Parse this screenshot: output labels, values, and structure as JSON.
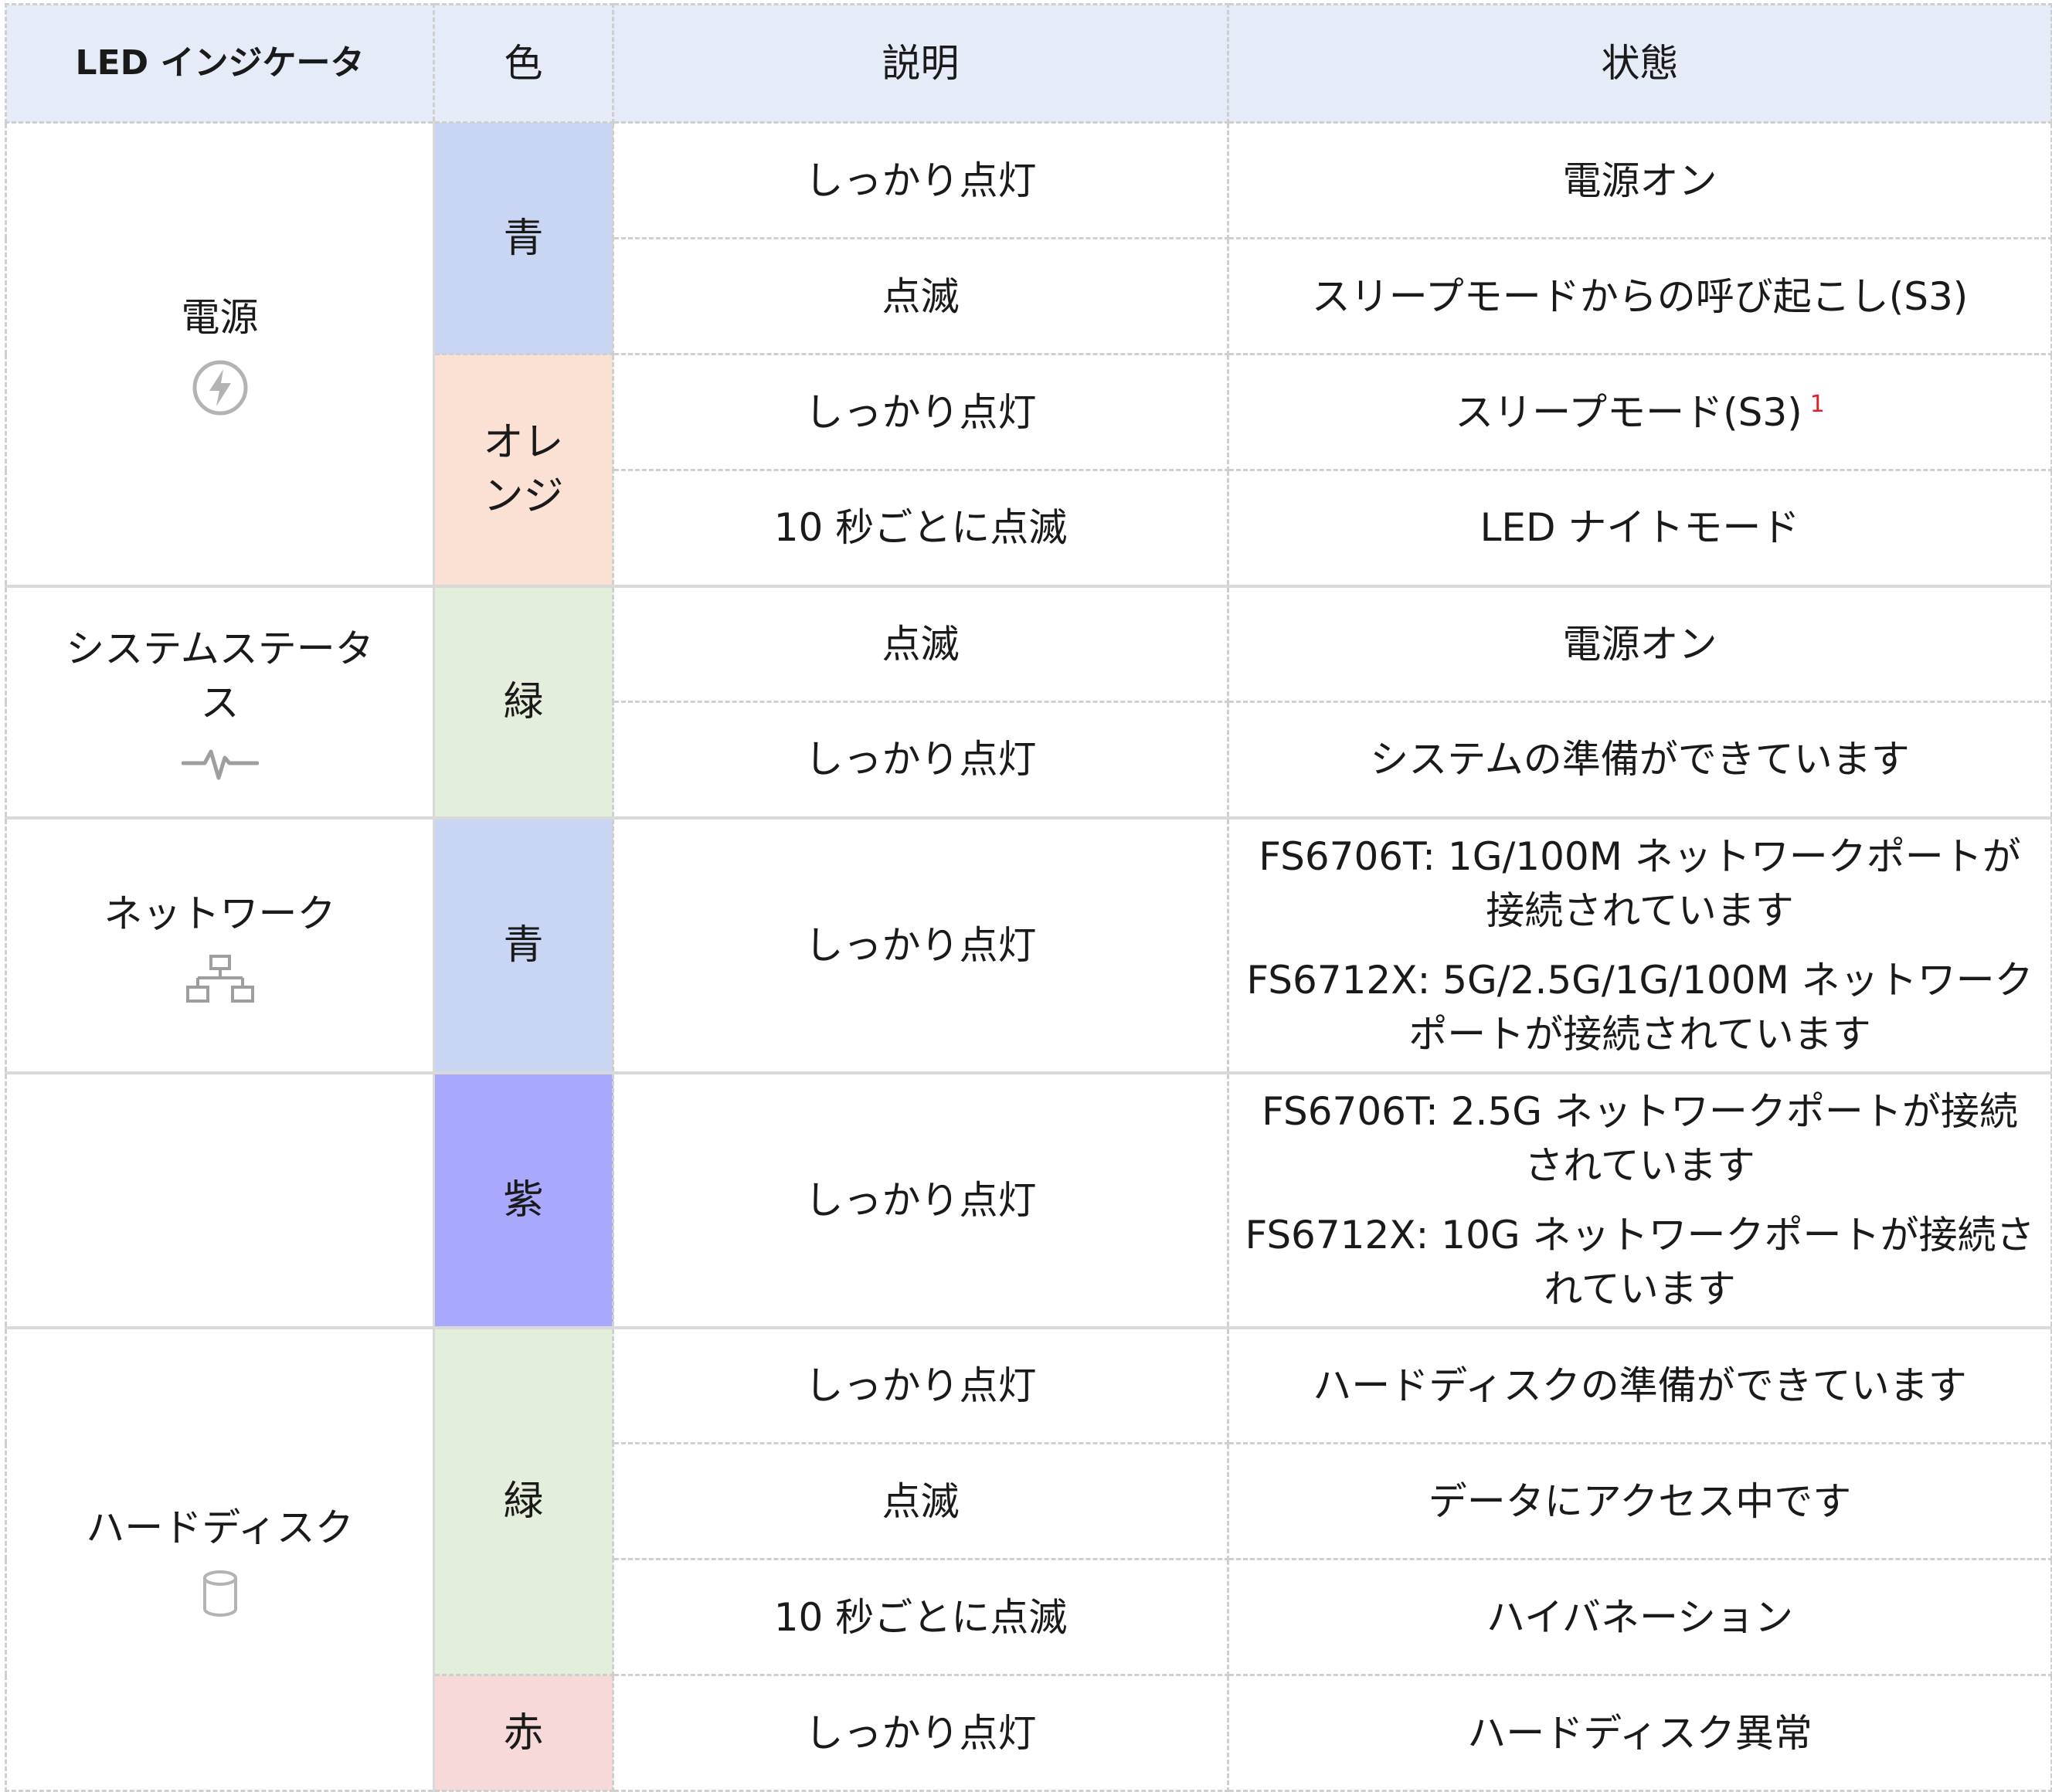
{
  "header": {
    "indicator": "LED インジケータ",
    "color": "色",
    "description": "説明",
    "status": "状態"
  },
  "rows": {
    "power": {
      "label": "電源",
      "icon": "power-bolt-icon",
      "blue": "青",
      "orange": "オレンジ",
      "r1": {
        "desc": "しっかり点灯",
        "status": "電源オン"
      },
      "r2": {
        "desc": "点滅",
        "status": "スリープモードからの呼び起こし(S3)"
      },
      "r3": {
        "desc": "しっかり点灯",
        "status": "スリープモード(S3)",
        "footnote": "1"
      },
      "r4": {
        "desc": "10 秒ごとに点滅",
        "status": "LED ナイトモード"
      }
    },
    "system": {
      "label": "システムステータス",
      "icon": "heartbeat-pulse-icon",
      "green": "緑",
      "r1": {
        "desc": "点滅",
        "status": "電源オン"
      },
      "r2": {
        "desc": "しっかり点灯",
        "status": "システムの準備ができています"
      }
    },
    "network": {
      "label": "ネットワーク",
      "icon": "network-topology-icon",
      "blue": "青",
      "purple": "紫",
      "r1": {
        "desc": "しっかり点灯",
        "status_a": "FS6706T: 1G/100M ネットワークポートが接続されています",
        "status_b": "FS6712X: 5G/2.5G/1G/100M ネットワークポートが接続されています"
      },
      "r2": {
        "desc": "しっかり点灯",
        "status_a": "FS6706T: 2.5G ネットワークポートが接続されています",
        "status_b": "FS6712X: 10G ネットワークポートが接続されています"
      }
    },
    "disk": {
      "label": "ハードディスク",
      "icon": "disk-cylinder-icon",
      "green": "緑",
      "red": "赤",
      "r1": {
        "desc": "しっかり点灯",
        "status": "ハードディスクの準備ができています"
      },
      "r2": {
        "desc": "点滅",
        "status": "データにアクセス中です"
      },
      "r3": {
        "desc": "10 秒ごとに点滅",
        "status": "ハイバネーション"
      },
      "r4": {
        "desc": "しっかり点灯",
        "status": "ハードディスク異常"
      }
    }
  },
  "colors": {
    "header_bg": "#e6ecf7",
    "blue": "#c9d6f3",
    "orange": "#fbe0d4",
    "green": "#e3eedb",
    "purple": "#a8a9fc",
    "red": "#f8d9d9",
    "footnote": "#e0202a"
  }
}
